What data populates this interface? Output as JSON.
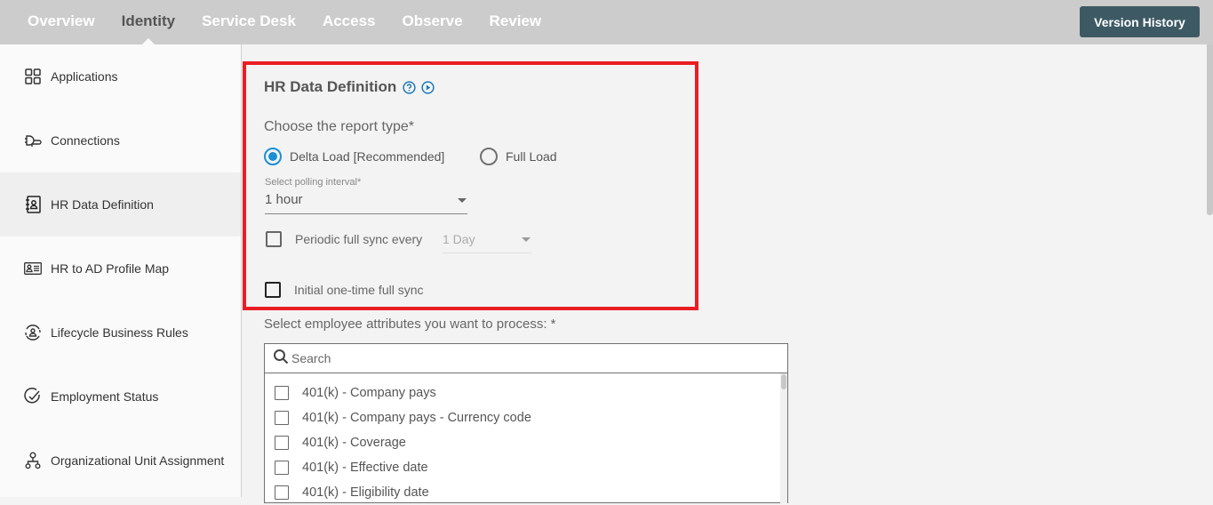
{
  "topnav": {
    "tabs": [
      {
        "label": "Overview",
        "active": false
      },
      {
        "label": "Identity",
        "active": true
      },
      {
        "label": "Service Desk",
        "active": false
      },
      {
        "label": "Access",
        "active": false
      },
      {
        "label": "Observe",
        "active": false
      },
      {
        "label": "Review",
        "active": false
      }
    ],
    "version_history_label": "Version History"
  },
  "sidebar": {
    "items": [
      {
        "label": "Applications",
        "icon": "grid-icon",
        "active": false
      },
      {
        "label": "Connections",
        "icon": "plug-icon",
        "active": false
      },
      {
        "label": "HR Data Definition",
        "icon": "contact-book-icon",
        "active": true
      },
      {
        "label": "HR to AD Profile Map",
        "icon": "id-card-icon",
        "active": false
      },
      {
        "label": "Lifecycle Business Rules",
        "icon": "user-cycle-icon",
        "active": false
      },
      {
        "label": "Employment Status",
        "icon": "check-circle-icon",
        "active": false
      },
      {
        "label": "Organizational Unit Assignment",
        "icon": "org-chart-icon",
        "active": false
      }
    ]
  },
  "section": {
    "title": "HR Data Definition",
    "help_icon": "help-circle-icon",
    "play_icon": "play-circle-icon",
    "report_type_label": "Choose the report type*",
    "report_types": [
      {
        "label": "Delta Load [Recommended]",
        "selected": true
      },
      {
        "label": "Full Load",
        "selected": false
      }
    ],
    "polling_label": "Select polling interval*",
    "polling_value": "1 hour",
    "periodic_sync": {
      "label": "Periodic full sync every",
      "checked": false,
      "value": "1 Day"
    },
    "initial_sync": {
      "label": "Initial one-time full sync",
      "checked": false
    }
  },
  "attributes": {
    "label": "Select employee attributes you want to process: *",
    "search_placeholder": "Search",
    "items": [
      {
        "label": "401(k) - Company pays",
        "checked": false
      },
      {
        "label": "401(k) - Company pays - Currency code",
        "checked": false
      },
      {
        "label": "401(k) - Coverage",
        "checked": false
      },
      {
        "label": "401(k) - Effective date",
        "checked": false
      },
      {
        "label": "401(k) - Eligibility date",
        "checked": false
      }
    ]
  },
  "colors": {
    "accent": "#1a8fd6",
    "highlight_border": "#ea1d24",
    "button_bg": "#3d5a64",
    "topbar_bg": "#cccccc"
  }
}
